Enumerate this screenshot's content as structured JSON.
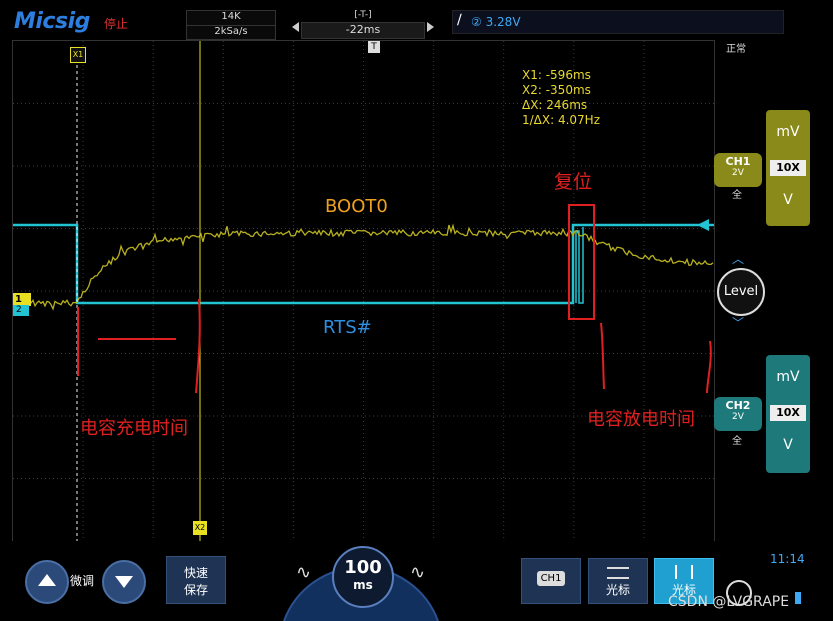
{
  "header": {
    "brand": "Micsig",
    "run_state": "停止",
    "memory_depth": "14K",
    "sample_rate": "2kSa/s",
    "trigger_pos_marker": "[-T-]",
    "time_offset": "-22ms",
    "trigger_channel_icon": "②",
    "trigger_level": "3.28V"
  },
  "status": {
    "trigger_mode": "正常",
    "time": "11:14"
  },
  "measurements": {
    "x1": "X1:  -596ms",
    "x2": "X2:  -350ms",
    "dx": "ΔX:  246ms",
    "inv_dx": "1/ΔX:  4.07Hz"
  },
  "cursors": {
    "x1_label": "X1",
    "x2_label": "X2",
    "trigger_label": "T"
  },
  "annotations": {
    "boot0": "BOOT0",
    "rts": "RTS#",
    "reset": "复位",
    "cap_charge": "电容充电时间",
    "cap_discharge": "电容放电时间"
  },
  "channels": {
    "ch1": {
      "name": "CH1",
      "scale": "2V",
      "coupling": "全",
      "unit_top": "mV",
      "probe": "10X",
      "unit_bottom": "V",
      "marker": "1",
      "color": "#c8c020"
    },
    "ch2": {
      "name": "CH2",
      "scale": "2V",
      "coupling": "全",
      "unit_top": "mV",
      "probe": "10X",
      "unit_bottom": "V",
      "marker": "2",
      "color": "#20c0d0"
    }
  },
  "controls": {
    "level": "Level",
    "fine_adjust": "微调",
    "quick_save_line1": "快速",
    "quick_save_line2": "保存",
    "timebase_value": "100",
    "timebase_unit": "ms",
    "ch1_menu": "CH1",
    "cursor_menu": "光标",
    "cursor_active": "光标"
  },
  "watermark": "CSDN @LVGRAPE"
}
